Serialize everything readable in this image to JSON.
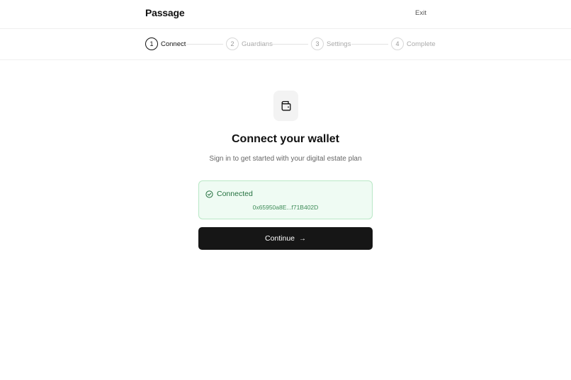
{
  "app": {
    "brand": "Passage",
    "exit_label": "Exit"
  },
  "stepper": {
    "steps": [
      {
        "number": "1",
        "label": "Connect",
        "active": true
      },
      {
        "number": "2",
        "label": "Guardians",
        "active": false
      },
      {
        "number": "3",
        "label": "Settings",
        "active": false
      },
      {
        "number": "4",
        "label": "Complete",
        "active": false
      }
    ]
  },
  "main": {
    "icon": "wallet-icon",
    "title": "Connect your wallet",
    "subtitle": "Sign in to get started with your digital estate plan",
    "status": {
      "icon": "check-circle-icon",
      "label": "Connected",
      "address": "0x65950a8E...f71B402D",
      "color": "#23703e"
    },
    "continue_label": "Continue",
    "continue_icon": "arrow-right-icon"
  },
  "colors": {
    "accent_dark": "#161616",
    "success_bg": "#effbf3",
    "success_border": "#b9e8c6",
    "success_text": "#23703e"
  }
}
